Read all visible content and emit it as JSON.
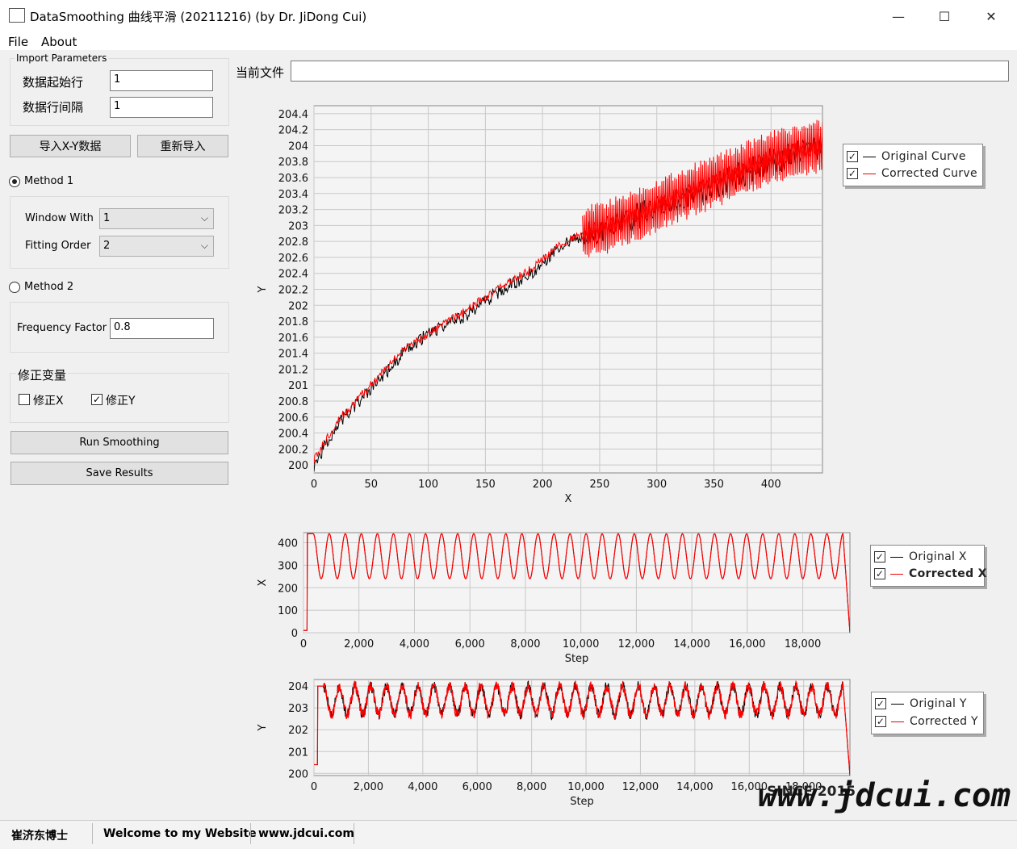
{
  "window": {
    "title": "DataSmoothing 曲线平滑 (20211216) (by Dr. JiDong Cui)",
    "minimize": "—",
    "maximize": "☐",
    "close": "✕"
  },
  "menu": [
    "File",
    "About"
  ],
  "import": {
    "group_title": "Import Parameters",
    "start_row_label": "数据起始行",
    "start_row_value": "1",
    "row_interval_label": "数据行间隔",
    "row_interval_value": "1",
    "import_button": "导入X-Y数据",
    "reimport_button": "重新导入"
  },
  "method1": {
    "label": "Method 1",
    "selected": true,
    "window_label": "Window With",
    "window_value": "1",
    "order_label": "Fitting Order",
    "order_value": "2"
  },
  "method2": {
    "label": "Method 2",
    "selected": false,
    "factor_label": "Frequency Factor",
    "factor_value": "0.8"
  },
  "correction": {
    "group_title": "修正变量",
    "x_label": "修正X",
    "x_checked": false,
    "y_label": "修正Y",
    "y_checked": true
  },
  "actions": {
    "run": "Run Smoothing",
    "save": "Save Results"
  },
  "current_file": {
    "label": "当前文件",
    "value": ""
  },
  "colors": {
    "original": "#000000",
    "corrected": "#ff0000"
  },
  "chart_data": [
    {
      "type": "line",
      "xlabel": "X",
      "ylabel": "Y",
      "xlim": [
        0,
        445
      ],
      "ylim": [
        199.9,
        204.5
      ],
      "x_ticks": [
        "0",
        "50",
        "100",
        "150",
        "200",
        "250",
        "300",
        "350",
        "400"
      ],
      "y_ticks": [
        "200",
        "200.2",
        "200.4",
        "200.6",
        "200.8",
        "201",
        "201.2",
        "201.4",
        "201.6",
        "201.8",
        "202",
        "202.2",
        "202.4",
        "202.6",
        "202.8",
        "203",
        "203.2",
        "203.4",
        "203.6",
        "203.8",
        "204",
        "204.2",
        "204.4"
      ],
      "grid": true,
      "legend": "right",
      "series": [
        {
          "name": "Original Curve",
          "x": [
            0,
            20,
            50,
            75,
            100,
            130,
            160,
            190,
            215,
            235,
            260,
            300,
            350,
            400,
            445
          ],
          "y": [
            200.0,
            200.5,
            200.95,
            201.35,
            201.65,
            201.85,
            202.15,
            202.4,
            202.75,
            202.85,
            203.0,
            203.2,
            203.5,
            203.8,
            204.0
          ]
        },
        {
          "name": "Corrected Curve",
          "x": [
            0,
            20,
            50,
            75,
            100,
            130,
            160,
            190,
            215,
            235,
            260,
            300,
            350,
            400,
            445
          ],
          "y": [
            200.05,
            200.55,
            201.0,
            201.4,
            201.65,
            201.9,
            202.2,
            202.45,
            202.75,
            202.9,
            203.0,
            203.25,
            203.55,
            203.85,
            204.0
          ]
        }
      ]
    },
    {
      "type": "line",
      "xlabel": "Step",
      "ylabel": "X",
      "xlim": [
        0,
        19700
      ],
      "ylim": [
        0,
        445
      ],
      "x_ticks": [
        "0",
        "2,000",
        "4,000",
        "6,000",
        "8,000",
        "10,000",
        "12,000",
        "14,000",
        "16,000",
        "18,000"
      ],
      "y_ticks": [
        "0",
        "100",
        "200",
        "300",
        "400"
      ],
      "grid": true,
      "legend": "right",
      "series": [
        {
          "name": "Original X"
        },
        {
          "name": "Corrected X"
        }
      ],
      "oscillation": {
        "start": 0,
        "rise_end": 350,
        "low": 240,
        "high": 440,
        "cycles": 33,
        "fall_start": 19450,
        "end": 19700
      }
    },
    {
      "type": "line",
      "xlabel": "Step",
      "ylabel": "Y",
      "xlim": [
        0,
        19700
      ],
      "ylim": [
        199.9,
        204.3
      ],
      "x_ticks": [
        "0",
        "2,000",
        "4,000",
        "6,000",
        "8,000",
        "10,000",
        "12,000",
        "14,000",
        "16,000",
        "18,000"
      ],
      "y_ticks": [
        "200",
        "201",
        "202",
        "203",
        "204"
      ],
      "grid": true,
      "legend": "right",
      "series": [
        {
          "name": "Original Y"
        },
        {
          "name": "Corrected Y"
        }
      ],
      "oscillation": {
        "start": 0,
        "rise_end": 350,
        "low": 202.7,
        "high": 204.0,
        "cycles": 33,
        "fall_start": 19450,
        "end": 19700
      }
    }
  ],
  "status": {
    "author": "崔济东博士",
    "welcome": "Welcome to my Website",
    "url": "www.jdcui.com"
  },
  "watermark": {
    "since": "SINCE 2015",
    "site": "www.jdcui.com"
  }
}
